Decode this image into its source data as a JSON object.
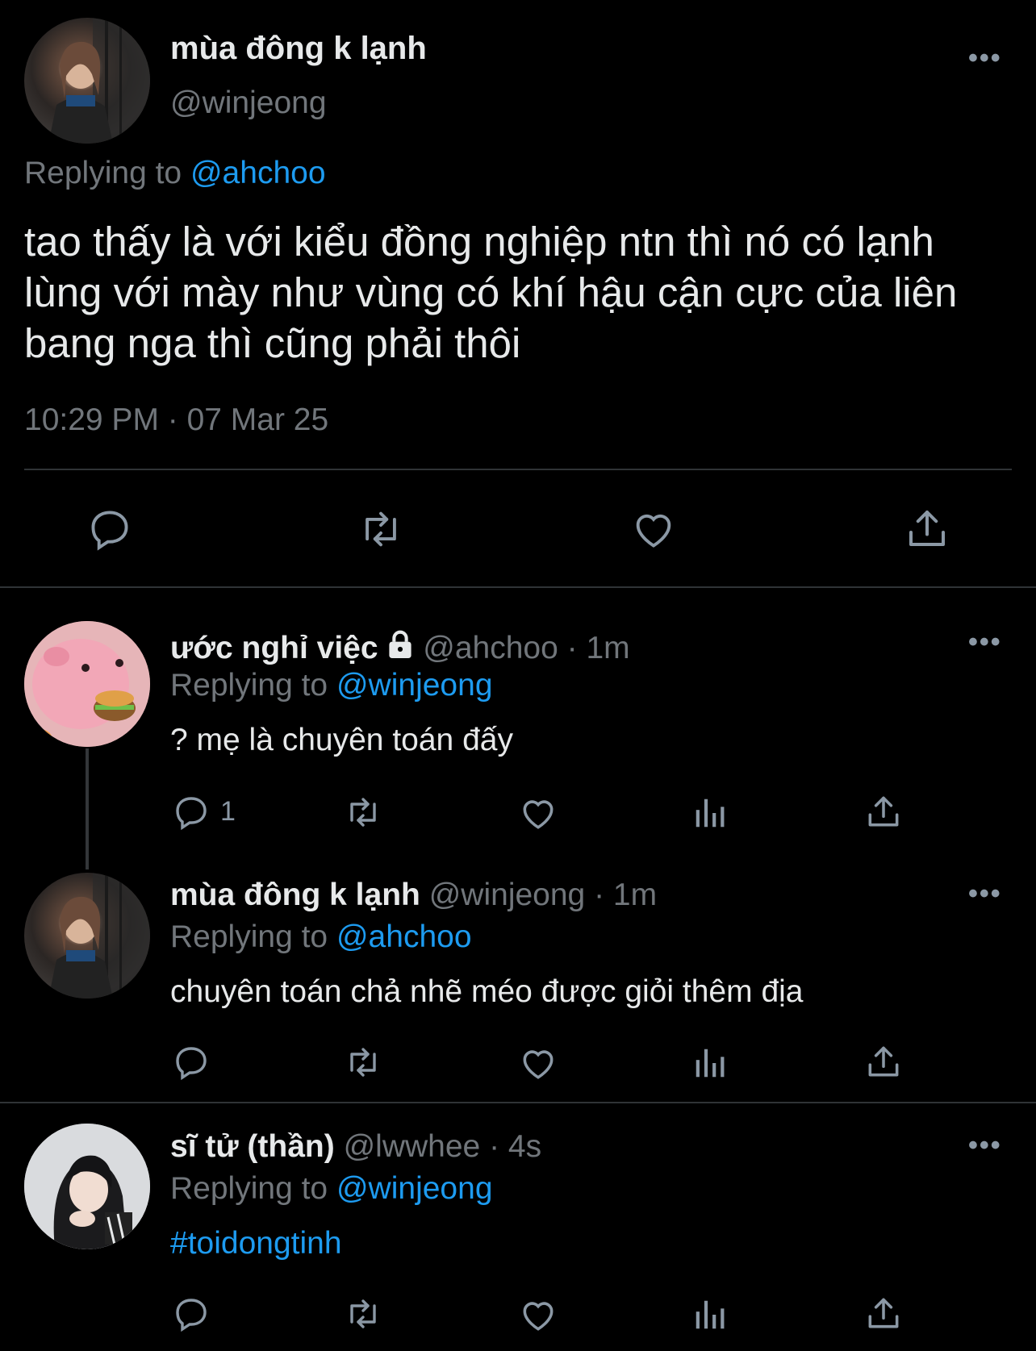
{
  "main_tweet": {
    "name": "mùa đông k lạnh",
    "handle": "@winjeong",
    "replying_label": "Replying to",
    "replying_to": "@ahchoo",
    "text": "tao thấy là với kiểu đồng nghiệp ntn thì nó có lạnh lùng với mày như vùng có khí hậu cận cực của liên bang nga thì cũng phải thôi",
    "timestamp": "10:29 PM · 07 Mar 25"
  },
  "replies": [
    {
      "name": "ước nghỉ việc",
      "handle": "@ahchoo",
      "time": "· 1m",
      "replying_label": "Replying to",
      "replying_to": "@winjeong",
      "text": "? mẹ là chuyên toán đấy",
      "reply_count": "1"
    },
    {
      "name": "mùa đông k lạnh",
      "handle": "@winjeong",
      "time": "· 1m",
      "replying_label": "Replying to",
      "replying_to": "@ahchoo",
      "text": "chuyên toán chả nhẽ méo được giỏi thêm địa"
    },
    {
      "name": "sĩ tử (thần)",
      "handle": "@lwwhee",
      "time": "· 4s",
      "replying_label": "Replying to",
      "replying_to": "@winjeong",
      "text": "#toidongtinh"
    }
  ],
  "colors": {
    "background": "#000000",
    "text": "#e7e9ea",
    "muted": "#71767b",
    "link": "#1d9bf0",
    "divider": "#2f3336"
  },
  "icons": [
    "reply-icon",
    "retweet-icon",
    "like-icon",
    "views-icon",
    "share-icon",
    "more-icon",
    "lock-icon"
  ]
}
